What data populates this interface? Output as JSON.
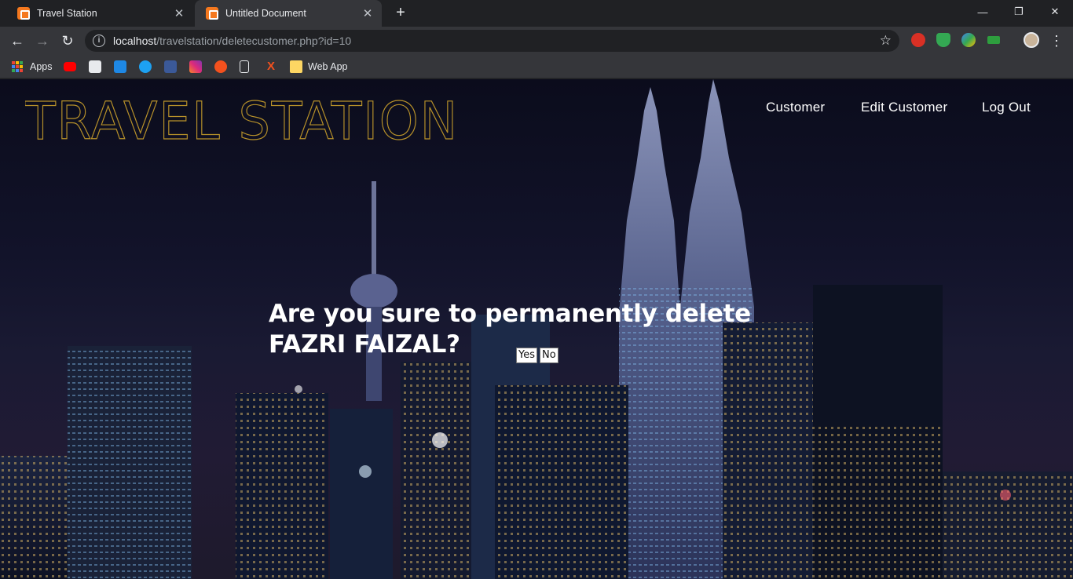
{
  "browser": {
    "tabs": [
      {
        "title": "Travel Station",
        "close": "✕"
      },
      {
        "title": "Untitled Document",
        "close": "✕"
      }
    ],
    "new_tab": "+",
    "window_controls": {
      "minimize": "—",
      "restore": "❐",
      "close": "✕"
    },
    "url": {
      "host": "localhost",
      "path": "/travelstation/deletecustomer.php?id=10"
    },
    "bookmarks": {
      "apps": "Apps",
      "web_app": "Web App"
    }
  },
  "site": {
    "logo": "TRAVEL STATION",
    "nav": {
      "customer": "Customer",
      "edit_customer": "Edit Customer",
      "logout": "Log Out"
    }
  },
  "dialog": {
    "message": "Are you sure to permanently delete FAZRI FAIZAL?",
    "yes": "Yes",
    "no": "No"
  },
  "colors": {
    "logo_gold": "#b8922a",
    "page_text": "#ffffff"
  }
}
